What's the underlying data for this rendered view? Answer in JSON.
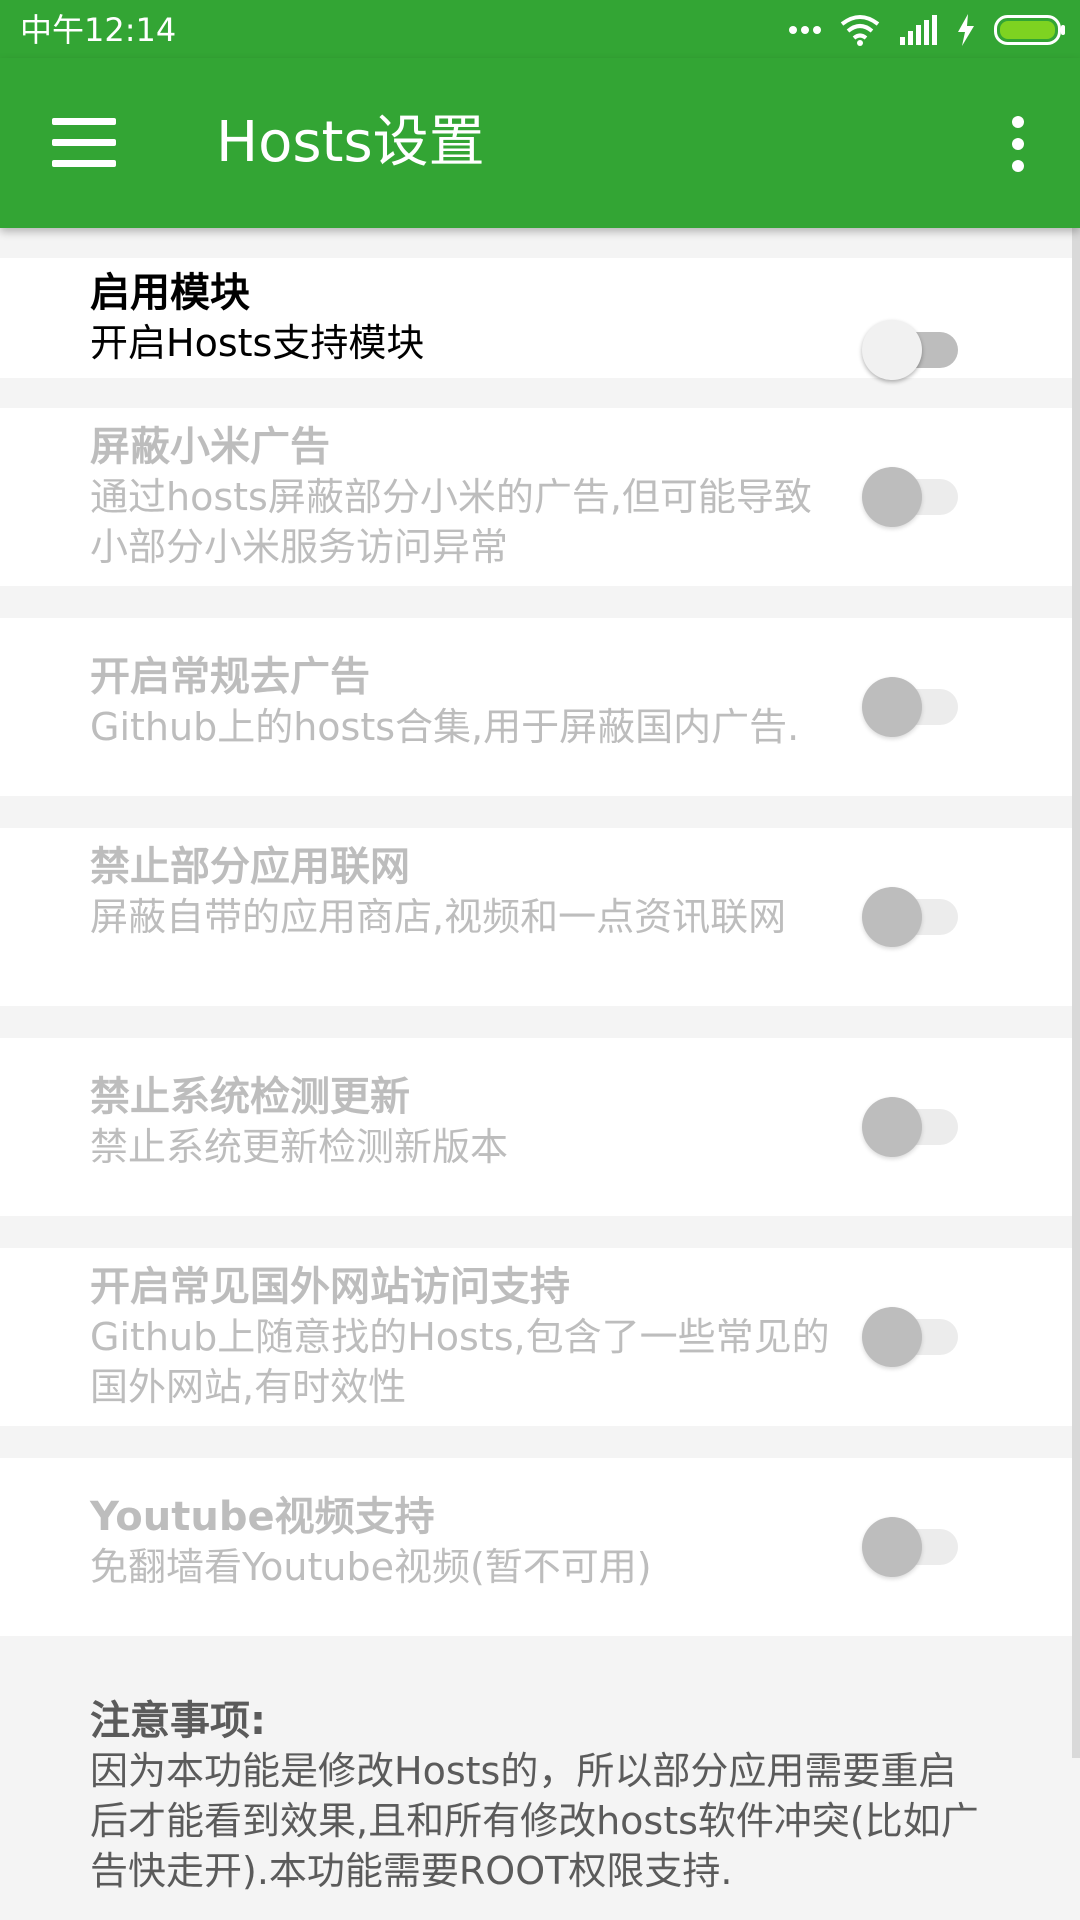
{
  "status_bar": {
    "time": "中午12:14",
    "icons": [
      "more-dots-icon",
      "wifi-icon",
      "signal-icon",
      "charging-icon",
      "battery-icon"
    ],
    "battery_color": "#7ed321"
  },
  "app_bar": {
    "title": "Hosts设置",
    "color": "#33a534",
    "menu_icon": "hamburger-menu-icon",
    "overflow_icon": "more-vert-icon"
  },
  "preferences": [
    {
      "id": "enable-module",
      "title": "启用模块",
      "summary": "开启Hosts支持模块",
      "enabled": true,
      "checked": false
    },
    {
      "id": "block-mi-ads",
      "title": "屏蔽小米广告",
      "summary": "通过hosts屏蔽部分小米的广告,但可能导致小部分小米服务访问异常",
      "enabled": false,
      "checked": false
    },
    {
      "id": "general-adblock",
      "title": "开启常规去广告",
      "summary": "Github上的hosts合集,用于屏蔽国内广告.",
      "enabled": false,
      "checked": false
    },
    {
      "id": "block-app-network",
      "title": "禁止部分应用联网",
      "summary": "屏蔽自带的应用商店,视频和一点资讯联网",
      "enabled": false,
      "checked": false
    },
    {
      "id": "block-system-update",
      "title": "禁止系统检测更新",
      "summary": "禁止系统更新检测新版本",
      "enabled": false,
      "checked": false
    },
    {
      "id": "foreign-sites",
      "title": "开启常见国外网站访问支持",
      "summary": "Github上随意找的Hosts,包含了一些常见的国外网站,有时效性",
      "enabled": false,
      "checked": false
    },
    {
      "id": "youtube-support",
      "title": "Youtube视频支持",
      "summary": "免翻墙看Youtube视频(暂不可用)",
      "enabled": false,
      "checked": false
    }
  ],
  "notes": {
    "heading": "注意事项:",
    "body": "因为本功能是修改Hosts的，所以部分应用需要重启后才能看到效果,且和所有修改hosts软件冲突(比如广告快走开).本功能需要ROOT权限支持."
  }
}
